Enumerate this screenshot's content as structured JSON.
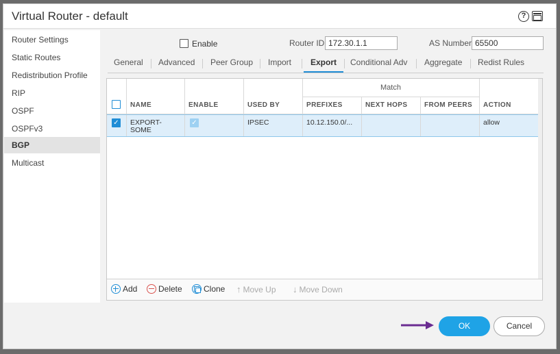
{
  "dialog": {
    "title": "Virtual Router - default",
    "help_icon": "?"
  },
  "sidebar": {
    "items": [
      {
        "label": "Router Settings"
      },
      {
        "label": "Static Routes"
      },
      {
        "label": "Redistribution Profile"
      },
      {
        "label": "RIP"
      },
      {
        "label": "OSPF"
      },
      {
        "label": "OSPFv3"
      },
      {
        "label": "BGP",
        "active": true
      },
      {
        "label": "Multicast"
      }
    ]
  },
  "bgp": {
    "enable_label": "Enable",
    "enable_checked": false,
    "router_id_label": "Router ID",
    "router_id_value": "172.30.1.1",
    "as_number_label": "AS Number",
    "as_number_value": "65500"
  },
  "tabs": [
    {
      "label": "General"
    },
    {
      "label": "Advanced"
    },
    {
      "label": "Peer Group"
    },
    {
      "label": "Import"
    },
    {
      "label": "Export",
      "active": true
    },
    {
      "label": "Conditional Adv"
    },
    {
      "label": "Aggregate"
    },
    {
      "label": "Redist Rules"
    }
  ],
  "table": {
    "group_header": "Match",
    "columns": [
      "NAME",
      "ENABLE",
      "USED BY",
      "PREFIXES",
      "NEXT HOPS",
      "FROM PEERS",
      "ACTION"
    ],
    "rows": [
      {
        "selected": true,
        "name_line1": "EXPORT-",
        "name_line2": "SOME",
        "enable": true,
        "used_by": "IPSEC",
        "prefixes": "10.12.150.0/...",
        "next_hops": "",
        "from_peers": "",
        "action": "allow"
      }
    ]
  },
  "toolbar": {
    "add": "Add",
    "delete": "Delete",
    "clone": "Clone",
    "move_up": "Move Up",
    "move_down": "Move Down"
  },
  "buttons": {
    "ok": "OK",
    "cancel": "Cancel"
  },
  "colors": {
    "accent": "#1fa3e6",
    "selection": "#deeefa",
    "pointer_arrow": "#6a2c91"
  }
}
